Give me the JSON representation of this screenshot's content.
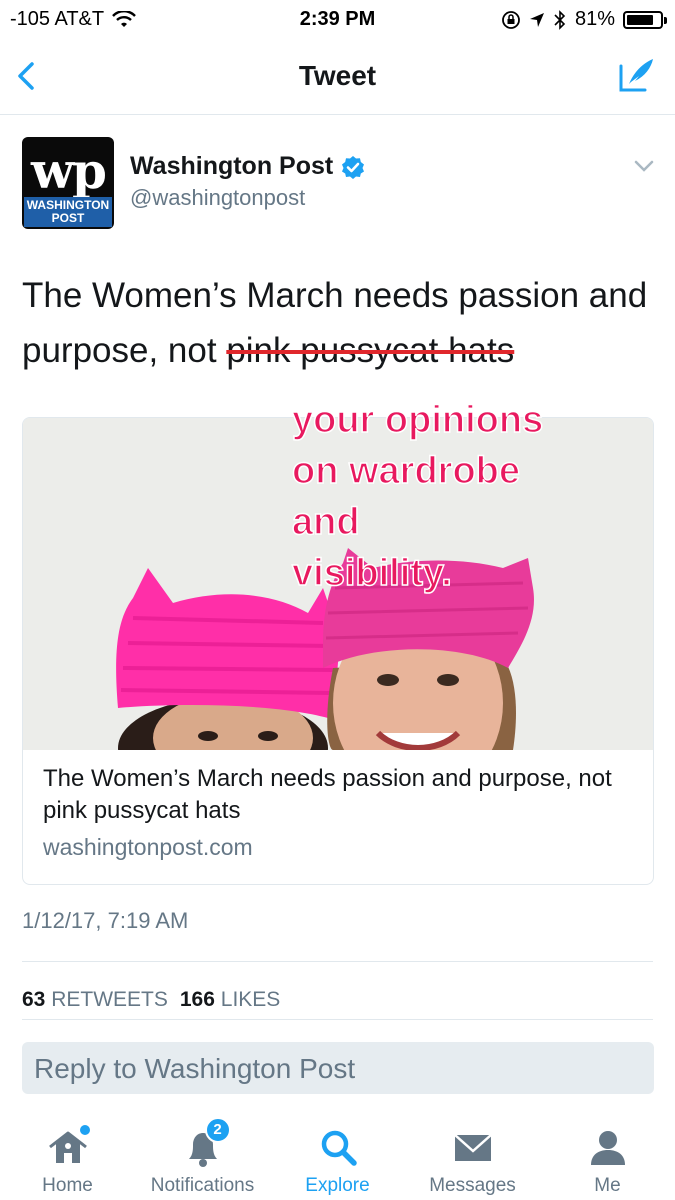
{
  "status_bar": {
    "carrier": "-105 AT&T",
    "time": "2:39 PM",
    "battery": "81%",
    "battery_level": 0.81
  },
  "nav": {
    "title": "Tweet"
  },
  "tweet": {
    "author_name": "Washington Post",
    "author_handle": "@washingtonpost",
    "avatar_monogram": "wp",
    "avatar_label": "WASHINGTON POST",
    "text_plain": "The Women’s March needs passion and purpose, not ",
    "text_struck": "pink pussycat hats",
    "overlay_lines": [
      "your opinions",
      "on wardrobe",
      "and",
      "visibility."
    ],
    "card_title": "The Women’s March needs passion and purpose, not pink pussycat hats",
    "card_domain": "washingtonpost.com",
    "timestamp": "1/12/17, 7:19 AM",
    "retweets_count": "63",
    "retweets_label": "RETWEETS",
    "likes_count": "166",
    "likes_label": "LIKES"
  },
  "reply": {
    "placeholder": "Reply to Washington Post"
  },
  "tabs": [
    {
      "label": "Home",
      "icon": "home-icon"
    },
    {
      "label": "Notifications",
      "icon": "bell-icon",
      "badge": "2"
    },
    {
      "label": "Explore",
      "icon": "search-icon"
    },
    {
      "label": "Messages",
      "icon": "envelope-icon"
    },
    {
      "label": "Me",
      "icon": "person-icon"
    }
  ],
  "colors": {
    "accent": "#1da1f2",
    "overlay_text": "#e8195f",
    "strike": "#e0272c"
  }
}
